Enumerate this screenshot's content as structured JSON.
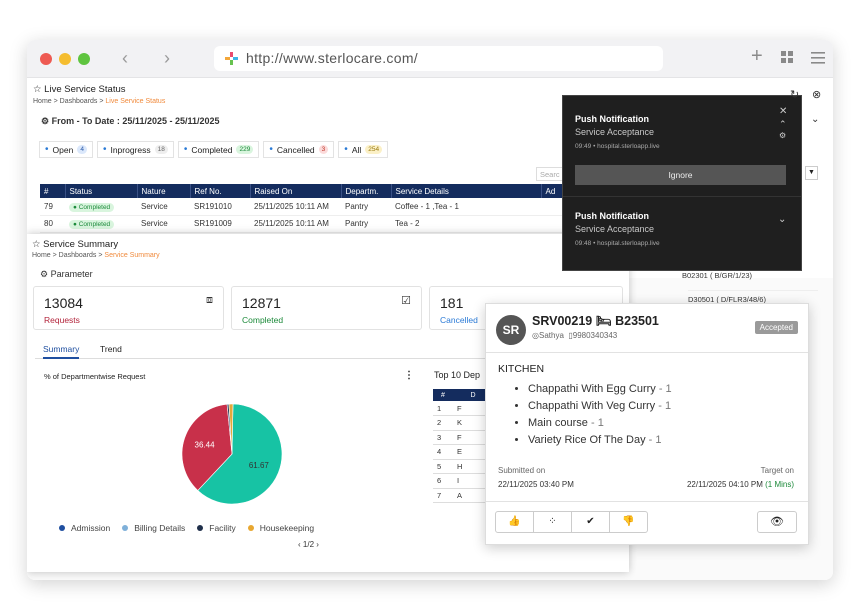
{
  "browser": {
    "url": "http://www.sterlocare.com/"
  },
  "live": {
    "title": "Live Service Status",
    "crumb": [
      "Home",
      "Dashboards",
      "Live Service Status"
    ],
    "date_range": "From - To Date : 25/11/2025 - 25/11/2025",
    "pills": [
      {
        "label": "Open",
        "count": "4",
        "color": "#dbe8fb",
        "tc": "#2a5aa8"
      },
      {
        "label": "Inprogress",
        "count": "18",
        "color": "#eeeeee",
        "tc": "#666666"
      },
      {
        "label": "Completed",
        "count": "229",
        "color": "#d9f5de",
        "tc": "#1c8a3a"
      },
      {
        "label": "Cancelled",
        "count": "3",
        "color": "#fbdada",
        "tc": "#c0392b"
      },
      {
        "label": "All",
        "count": "254",
        "color": "#fbf0c6",
        "tc": "#9a7a10"
      }
    ],
    "search_placeholder": "Searc",
    "columns": [
      "#",
      "Status",
      "Nature",
      "Ref No.",
      "Raised On",
      "Departm.",
      "Service Details",
      "Ad"
    ],
    "rows": [
      [
        "79",
        "Completed",
        "Service",
        "SR191010",
        "25/11/2025 10:11 AM",
        "Pantry",
        "Coffee - 1 ,Tea - 1"
      ],
      [
        "80",
        "Completed",
        "Service",
        "SR191009",
        "25/11/2025 10:11 AM",
        "Pantry",
        "Tea - 2"
      ]
    ],
    "right_locs": [
      "B02301 ( B/GR/1/23)",
      "D30501 ( D/FLR3/48/6)"
    ]
  },
  "summary": {
    "title": "Service Summary",
    "crumb": [
      "Home",
      "Dashboards",
      "Service Summary"
    ],
    "parameter_label": "Parameter",
    "cards": [
      {
        "value": "13084",
        "label": "Requests",
        "color": "#b3243b"
      },
      {
        "value": "12871",
        "label": "Completed",
        "color": "#1c8a3a"
      },
      {
        "value": "181",
        "label": "Cancelled",
        "color": "#2a7ad6"
      }
    ],
    "tabs": [
      "Summary",
      "Trend"
    ],
    "chart_title": "% of Departmentwise Request",
    "top10_title": "Top 10 Dep",
    "top10_rows": [
      [
        "1",
        "F"
      ],
      [
        "2",
        "K"
      ],
      [
        "3",
        "F"
      ],
      [
        "4",
        "E"
      ],
      [
        "5",
        "H"
      ],
      [
        "6",
        "I"
      ],
      [
        "7",
        "A"
      ]
    ],
    "pagination": "1/2"
  },
  "chart_data": {
    "type": "pie",
    "title": "% of Departmentwise Request",
    "categories": [
      "Admission",
      "Billing Details",
      "Facility",
      "Housekeeping"
    ],
    "slices": [
      {
        "label": "Housekeeping",
        "value": 61.67,
        "color": "#17c3a4"
      },
      {
        "label": "Facility",
        "value": 36.44,
        "color": "#c8304a"
      },
      {
        "label": "Billing Details",
        "value": 0.6,
        "color": "#2a3f5f"
      },
      {
        "label": "Admission",
        "value": 1.29,
        "color": "#e3a93a"
      }
    ],
    "legend": [
      {
        "label": "Admission",
        "color": "#1f4fa0"
      },
      {
        "label": "Billing Details",
        "color": "#7fb0d9"
      },
      {
        "label": "Facility",
        "color": "#1f2f4a"
      },
      {
        "label": "Housekeeping",
        "color": "#e8a730"
      }
    ]
  },
  "push": [
    {
      "title": "Push Notification",
      "sub": "Service Acceptance",
      "meta": "09:49 • hospital.sterloapp.live",
      "button": "Ignore"
    },
    {
      "title": "Push Notification",
      "sub": "Service Acceptance",
      "meta": "09:48 • hospital.sterloapp.live"
    }
  ],
  "order": {
    "initials": "SR",
    "ref": "SRV00219",
    "room": "B23501",
    "user": "Sathya",
    "phone": "9980340343",
    "status": "Accepted",
    "section": "KITCHEN",
    "items": [
      {
        "name": "Chappathi With Egg Curry",
        "qty": " - 1"
      },
      {
        "name": "Chappathi With Veg Curry",
        "qty": " - 1"
      },
      {
        "name": "Main course",
        "qty": " - 1"
      },
      {
        "name": "Variety Rice Of The Day",
        "qty": " - 1"
      }
    ],
    "submitted_label": "Submitted on",
    "submitted": "22/11/2025 03:40 PM",
    "target_label": "Target on",
    "target": "22/11/2025 04:10 PM",
    "target_delta": "(1 Mins)"
  }
}
